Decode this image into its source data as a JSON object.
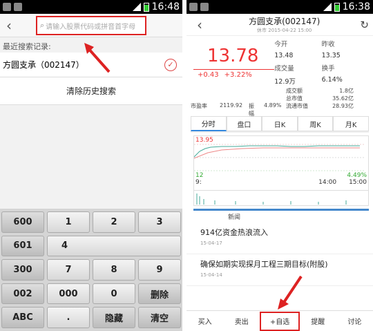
{
  "left": {
    "status": {
      "time": "16:48"
    },
    "search": {
      "placeholder": "请输入股票代码或拼音首字母"
    },
    "recent_label": "最近搜索记录:",
    "recent_items": [
      {
        "label": "方圆支承（002147）"
      }
    ],
    "clear_history": "清除历史搜索",
    "keys": {
      "k600": "600",
      "k1": "1",
      "k2": "2",
      "k3": "3",
      "k601": "601",
      "k4": "4",
      "k300": "300",
      "k7": "7",
      "k8": "8",
      "k9": "9",
      "k002": "002",
      "k000": "000",
      "k0": "0",
      "del": "删除",
      "abc": "ABC",
      "dot": ".",
      "hide": "隐藏",
      "clear": "清空"
    }
  },
  "right": {
    "status": {
      "time": "16:38"
    },
    "title": "方圆支承(002147)",
    "subtitle": "休市 2015-04-22 15:00",
    "price": "13.78",
    "change": "+0.43",
    "change_pct": "+3.22%",
    "quote": {
      "open_label": "今开",
      "open": "13.48",
      "prev_label": "昨收",
      "prev": "13.35",
      "vol_label": "成交量",
      "vol": "12.9万",
      "turn_label": "换手",
      "turn": "6.14%"
    },
    "stats": {
      "amount_label": "成交额",
      "amount": "1.8亿",
      "mcap_label": "总市值",
      "mcap": "35.62亿",
      "pe_label": "市盈率",
      "pe": "2119.92",
      "amp_label": "振　幅",
      "amp": "4.89%",
      "fmcap_label": "流通市值",
      "fmcap": "28.93亿"
    },
    "tabs": [
      "分时",
      "盘口",
      "日K",
      "周K",
      "月K"
    ],
    "chart": {
      "high": "13.95",
      "low": "12",
      "pct": "4.49%",
      "t0": "9:",
      "t1": "14:00",
      "t2": "15:00"
    },
    "news_tab": "新闻",
    "news": [
      {
        "headline": "914亿资金热浪流入",
        "date": "15-04-17"
      },
      {
        "headline": "确保如期实现探月工程三期目标(附股)",
        "date": "15-04-14"
      }
    ],
    "actions": [
      "买入",
      "卖出",
      "+自选",
      "提醒",
      "讨论"
    ]
  },
  "colors": {
    "up": "#e33",
    "down": "#3a3",
    "highlight": "#d22"
  }
}
